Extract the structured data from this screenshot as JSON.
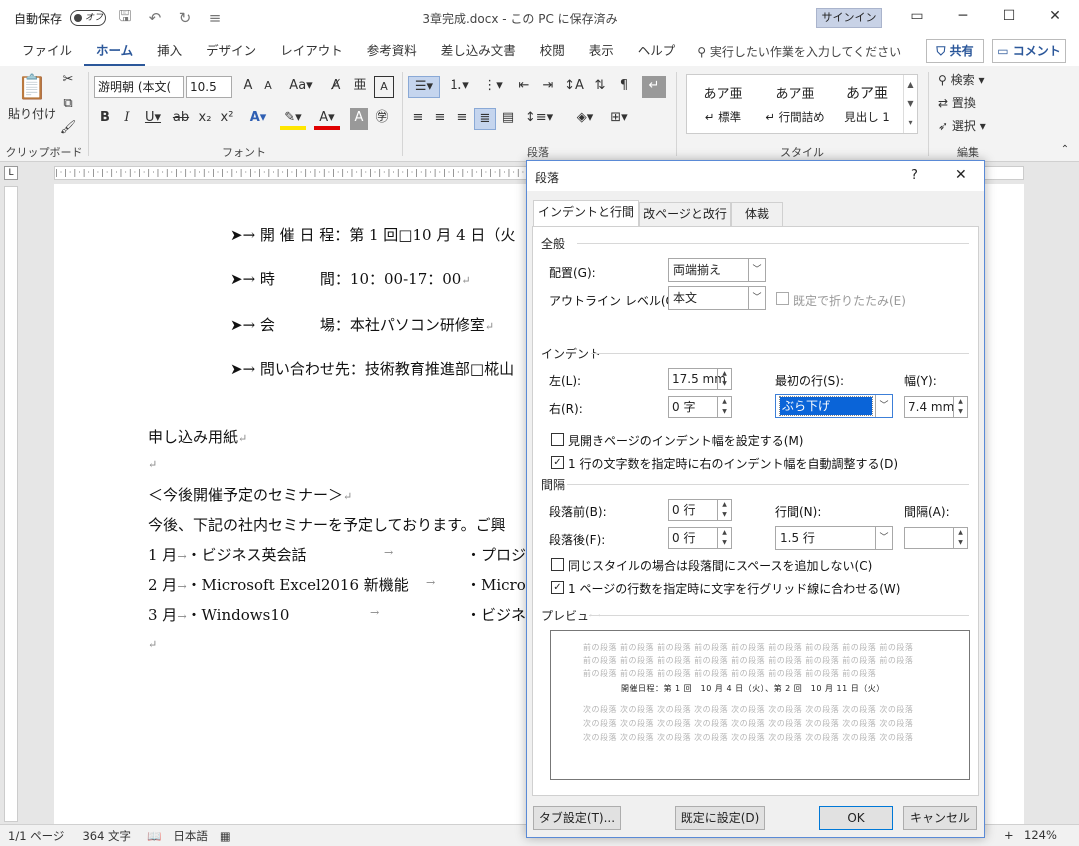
{
  "titlebar": {
    "autosave_label": "自動保存",
    "autosave_state": "オフ",
    "doc_title": "3章完成.docx - この PC に保存済み",
    "signin": "サインイン"
  },
  "tabs": [
    "ファイル",
    "ホーム",
    "挿入",
    "デザイン",
    "レイアウト",
    "参考資料",
    "差し込み文書",
    "校閲",
    "表示",
    "ヘルプ"
  ],
  "tell_me": "実行したい作業を入力してください",
  "share": "共有",
  "comment": "コメント",
  "ribbon": {
    "paste": "貼り付け",
    "font_name": "游明朝 (本文(",
    "font_size": "10.5",
    "styles": [
      "あア亜",
      "あア亜",
      "あア亜"
    ],
    "style_names": [
      "↵ 標準",
      "↵ 行間詰め",
      "見出し 1"
    ],
    "find": "検索",
    "replace": "置換",
    "select": "選択",
    "groups": [
      "クリップボード",
      "フォント",
      "段落",
      "スタイル",
      "編集"
    ]
  },
  "document": {
    "bullets": [
      "開 催 日 程：第 1 回□10 月 4 日（火",
      "時　　　間：10：00-17：00",
      "会　　　場：本社パソコン研修室",
      "問い合わせ先：技術教育推進部□椛山"
    ],
    "body": [
      "申し込み用紙",
      "＜今後開催予定のセミナー＞",
      "今後、下記の社内セミナーを予定しております。ご興"
    ],
    "schedule": [
      {
        "month": "1 月",
        "item": "・ビジネス英会話",
        "right": "・プロジ"
      },
      {
        "month": "2 月",
        "item": "・Microsoft Excel2016 新機能",
        "right": "・Micros"
      },
      {
        "month": "3 月",
        "item": "・Windows10",
        "right": "・ビジネ"
      }
    ]
  },
  "status": {
    "page": "1/1 ページ",
    "words": "364 文字",
    "lang": "日本語",
    "zoom": "124%"
  },
  "dialog": {
    "title": "段落",
    "help": "?",
    "close": "✕",
    "tabs": [
      "インデントと行間隔",
      "改ページと改行",
      "体裁"
    ],
    "general": "全般",
    "alignment_label": "配置(G):",
    "alignment_value": "両端揃え",
    "outline_label": "アウトライン レベル(O):",
    "outline_value": "本文",
    "collapse_label": "既定で折りたたみ(E)",
    "indent": "インデント",
    "left_label": "左(L):",
    "left_value": "17.5 mm",
    "right_label": "右(R):",
    "right_value": "0 字",
    "first_line_label": "最初の行(S):",
    "first_line_value": "ぶら下げ",
    "width_label": "幅(Y):",
    "width_value": "7.4 mm",
    "mirror_label": "見開きページのインデント幅を設定する(M)",
    "auto_adjust_label": "1 行の文字数を指定時に右のインデント幅を自動調整する(D)",
    "spacing": "間隔",
    "before_label": "段落前(B):",
    "before_value": "0 行",
    "after_label": "段落後(F):",
    "after_value": "0 行",
    "line_spacing_label": "行間(N):",
    "line_spacing_value": "1.5 行",
    "at_label": "間隔(A):",
    "at_value": "",
    "no_space_label": "同じスタイルの場合は段落間にスペースを追加しない(C)",
    "grid_label": "1 ページの行数を指定時に文字を行グリッド線に合わせる(W)",
    "preview": "プレビュー",
    "preview_prev": "前の段落 前の段落 前の段落 前の段落 前の段落 前の段落 前の段落 前の段落 前の段落 前の段落 前の段落 前の段落 前の段落 前の段落 前の段落 前の段落 前の段落 前の段落 前の段落 前の段落 前の段落 前の段落 前の段落 前の段落 前の段落 前の段落",
    "preview_current": "開催日程：第 1 回　10 月 4 日（火）、第 2 回　10 月 11 日（火）",
    "preview_next": "次の段落 次の段落 次の段落 次の段落 次の段落 次の段落 次の段落 次の段落 次の段落 次の段落 次の段落 次の段落 次の段落 次の段落 次の段落 次の段落 次の段落 次の段落 次の段落 次の段落 次の段落 次の段落 次の段落 次の段落 次の段落 次の段落 次の段落 次の段落 次の段落 次の段落 次の段落 次の段落 次の段落 次の段落 次の段落 次の段落",
    "tabs_button": "タブ設定(T)...",
    "default_button": "既定に設定(D)",
    "ok": "OK",
    "cancel": "キャンセル"
  }
}
